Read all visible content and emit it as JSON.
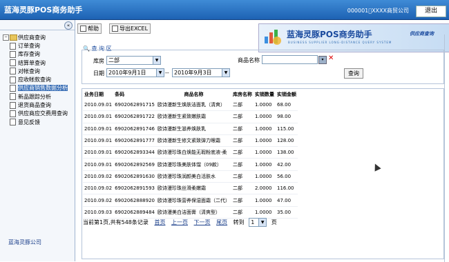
{
  "app": {
    "title": "蓝海灵豚POS商务助手",
    "company": "000001\u0000XXXX商贸公司",
    "logout_label": "退出"
  },
  "sidebar": {
    "root_label": "供应商查询",
    "items": [
      {
        "label": "订单查询"
      },
      {
        "label": "库存查询"
      },
      {
        "label": "结算单查询"
      },
      {
        "label": "对帐查询"
      },
      {
        "label": "应收帐款查询"
      },
      {
        "label": "供应商销售数据分析",
        "active": true
      },
      {
        "label": "新品跟踪分析"
      },
      {
        "label": "退货商品查询"
      },
      {
        "label": "供应商应交费用查询"
      },
      {
        "label": "意见反馈"
      }
    ],
    "footer": "蓝海灵豚公司"
  },
  "toolbar": {
    "help_label": "帮助",
    "export_label": "导出EXCEL"
  },
  "banner": {
    "title": "蓝海灵豚POS商务助手",
    "subtitle": "供应商查询",
    "english": "BUSINESS SUPPLIER LONG-DISTANCE QUERY SYSTEM"
  },
  "query": {
    "section_title": "查 询 区",
    "store_label": "库房",
    "store_value": "二部",
    "product_label": "商品名称",
    "product_value": "",
    "date_label": "日期",
    "date_from": "2010年9月1日",
    "date_sep": "--",
    "date_to": "2010年9月3日",
    "search_label": "查询"
  },
  "table": {
    "columns": [
      "业务日期",
      "条码",
      "商品名称",
      "库房名称",
      "实销数量",
      "实销金额"
    ],
    "rows": [
      [
        "2010.09.01",
        "6902062891715",
        "欧诗漫新生焕肤洁面乳（清爽）",
        "二部",
        "1.0000",
        "68.00"
      ],
      [
        "2010.09.01",
        "6902062891722",
        "欧诗漫新生紧致嫩肤霜",
        "二部",
        "1.0000",
        "98.00"
      ],
      [
        "2010.09.01",
        "6902062891746",
        "欧诗漫新生滋养焕肤乳",
        "二部",
        "1.0000",
        "115.00"
      ],
      [
        "2010.09.01",
        "6902062891777",
        "欧诗漫新生修文紧致弹力眼霜",
        "二部",
        "1.0000",
        "128.00"
      ],
      [
        "2010.09.01",
        "6902062893344",
        "欧诗漫珍珠白焕能无瑕粉底液-柔",
        "二部",
        "1.0000",
        "138.00"
      ],
      [
        "2010.09.01",
        "6902062892569",
        "欧诗漫珍珠美肤体馏（09款）",
        "二部",
        "1.0000",
        "42.00"
      ],
      [
        "2010.09.02",
        "6902062891630",
        "欧诗漫珍珠润颜美白活肤水",
        "二部",
        "1.0000",
        "56.00"
      ],
      [
        "2010.09.02",
        "6902062891593",
        "欧诗漫珍珠丝滑柔嫩霜",
        "二部",
        "2.0000",
        "116.00"
      ],
      [
        "2010.09.02",
        "6902062888920",
        "欧诗漫珍珠营养保湿面霜（二代）",
        "二部",
        "1.0000",
        "47.00"
      ],
      [
        "2010.09.03",
        "6902062889484",
        "欧诗漫美白洁面膏（清爽型）",
        "二部",
        "1.0000",
        "35.00"
      ]
    ]
  },
  "pager": {
    "summary": "当前第1页,共有548条记录",
    "first": "首页",
    "prev": "上一页",
    "next": "下一页",
    "last": "尾页",
    "goto_label": "转到",
    "page_value": "1",
    "page_suffix": "页"
  },
  "colors": {
    "header": "#1d62b3",
    "accent": "#1a4a9e"
  }
}
